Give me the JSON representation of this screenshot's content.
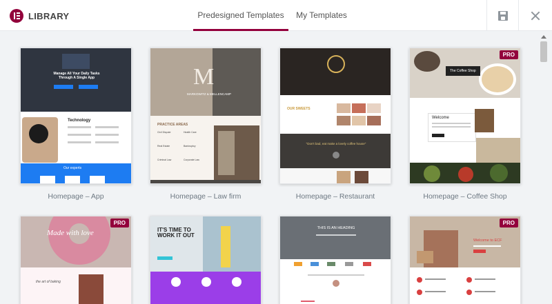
{
  "header": {
    "title": "LIBRARY",
    "tabs": [
      {
        "label": "Predesigned Templates",
        "active": true
      },
      {
        "label": "My Templates",
        "active": false
      }
    ],
    "save_icon": "save-icon",
    "close_icon": "close-icon"
  },
  "pro_badge": "PRO",
  "templates": [
    {
      "label": "Homepage – App",
      "pro": false,
      "hero": "Manage All Your Daily Tasks Through A Single App",
      "section": "Technology",
      "section2": "Our experts"
    },
    {
      "label": "Homepage – Law firm",
      "pro": false,
      "logo_letter": "M",
      "firm": "MARKOWITZ & MELLENCAMP",
      "section": "PRACTICE AREAS",
      "areas": [
        "Civil Dispute",
        "Health Care",
        "Real Estate",
        "Bankruptcy",
        "Criminal Law",
        "Corporate Law"
      ]
    },
    {
      "label": "Homepage – Restaurant",
      "pro": false,
      "section": "OUR SWEETS",
      "quote": "\"Don't bad, eat make a lovely coffee house\""
    },
    {
      "label": "Homepage – Coffee Shop",
      "pro": true,
      "badge": "The Coffee Shop",
      "section": "Welcome"
    },
    {
      "label": "",
      "pro": true,
      "hero": "Made with love",
      "section": "the art of baking"
    },
    {
      "label": "",
      "pro": false,
      "hero": "IT'S TIME TO WORK IT OUT"
    },
    {
      "label": "",
      "pro": false,
      "hero": "THIS IS AN HEADING"
    },
    {
      "label": "",
      "pro": true,
      "hero": "Welcome to ECF"
    }
  ],
  "colors": {
    "accent": "#93003c",
    "blue": "#1d7cf2",
    "purple": "#9b3ee8"
  }
}
